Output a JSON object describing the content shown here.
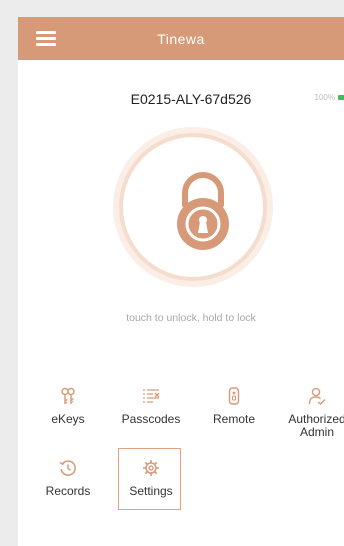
{
  "header": {
    "title": "Tinewa",
    "menu_icon": "hamburger-menu-icon"
  },
  "lock": {
    "name": "E0215-ALY-67d526",
    "battery": "100%",
    "battery_level": 1.0,
    "hint": "touch to unlock, hold to lock",
    "icon": "padlock-icon"
  },
  "menu_items": [
    {
      "label": "eKeys",
      "icon": "ekeys-icon"
    },
    {
      "label": "Passcodes",
      "icon": "passcodes-icon"
    },
    {
      "label": "Remote",
      "icon": "remote-icon"
    },
    {
      "label": "Authorized Admin",
      "icon": "authorized-admin-icon"
    },
    {
      "label": "Records",
      "icon": "records-icon"
    },
    {
      "label": "Settings",
      "icon": "settings-icon",
      "selected": true
    }
  ],
  "colors": {
    "accent": "#d79a78",
    "ring_outer": "#faeee7",
    "ring_mid": "#f5dccd",
    "battery": "#3fbf56",
    "selected_border": "#e0a27f"
  }
}
